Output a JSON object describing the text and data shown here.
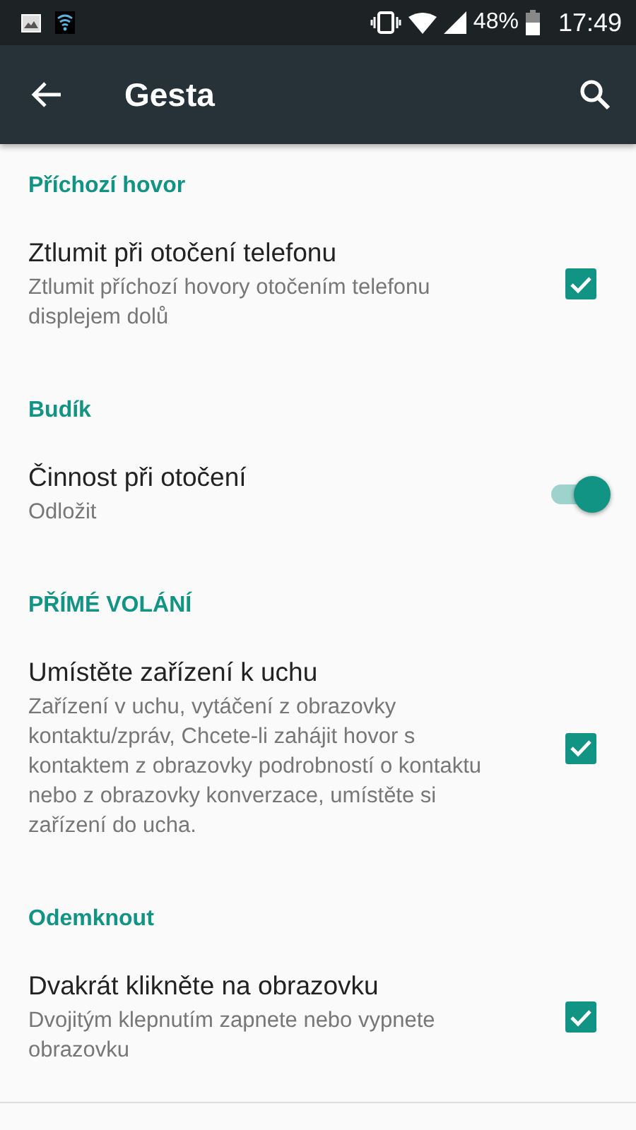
{
  "status_bar": {
    "battery": "48%",
    "time": "17:49"
  },
  "app_bar": {
    "title": "Gesta"
  },
  "sections": [
    {
      "header": "Příchozí hovor",
      "items": [
        {
          "kind": "checkbox",
          "title": "Ztlumit při otočení telefonu",
          "summary": "Ztlumit příchozí hovory otočením telefonu displejem dolů",
          "checked": true
        }
      ]
    },
    {
      "header": "Budík",
      "items": [
        {
          "kind": "switch",
          "title": "Činnost při otočení",
          "summary": "Odložit",
          "on": true
        }
      ]
    },
    {
      "header": "PŘÍMÉ VOLÁNÍ",
      "items": [
        {
          "kind": "checkbox",
          "title": "Umístěte zařízení k uchu",
          "summary": "Zařízení v uchu, vytáčení z obrazovky kontaktu/zpráv, Chcete-li zahájit hovor s kontaktem z obrazovky podrobností o kontaktu nebo z obrazovky konverzace, umístěte si zařízení do ucha.",
          "checked": true
        }
      ]
    },
    {
      "header": "Odemknout",
      "items": [
        {
          "kind": "checkbox",
          "title": "Dvakrát klikněte na obrazovku",
          "summary": "Dvojitým klepnutím zapnete nebo vypnete obrazovku",
          "checked": true
        }
      ]
    }
  ]
}
